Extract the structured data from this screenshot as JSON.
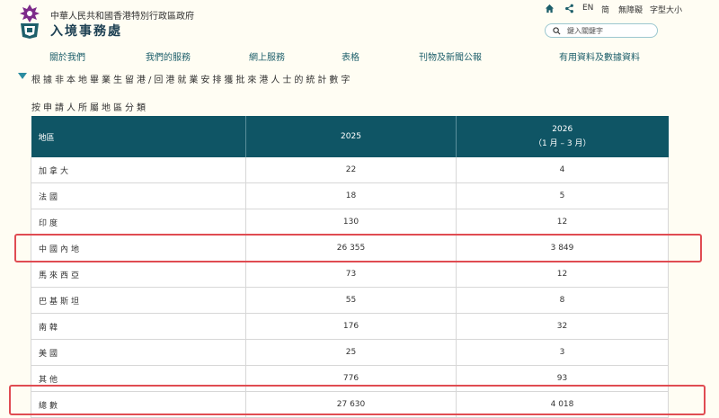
{
  "header": {
    "gov_name": "中華人民共和國香港特別行政區政府",
    "dept_name": "入境事務處",
    "lang_en": "EN",
    "lang_sc": "简",
    "accessibility": "無障礙",
    "font_size": "字型大小",
    "search_placeholder": "鍵入關鍵字"
  },
  "nav": {
    "items": [
      "關於我們",
      "我們的服務",
      "網上服務",
      "表格",
      "刊物及新聞公報",
      "有用資料及數據資料"
    ]
  },
  "section": {
    "title": "根據非本地畢業生留港/回港就業安排獲批來港人士的統計數字",
    "subtitle": "按申請人所屬地區分類"
  },
  "table": {
    "headers": {
      "region": "地區",
      "col1": "2025",
      "col2_year": "2026",
      "col2_period": "（1 月 – 3 月）"
    },
    "rows": [
      {
        "region": "加拿大",
        "v2025": "22",
        "v2026": "4"
      },
      {
        "region": "法國",
        "v2025": "18",
        "v2026": "5"
      },
      {
        "region": "印度",
        "v2025": "130",
        "v2026": "12"
      },
      {
        "region": "中國內地",
        "v2025": "26 355",
        "v2026": "3 849"
      },
      {
        "region": "馬來西亞",
        "v2025": "73",
        "v2026": "12"
      },
      {
        "region": "巴基斯坦",
        "v2025": "55",
        "v2026": "8"
      },
      {
        "region": "南韓",
        "v2025": "176",
        "v2026": "32"
      },
      {
        "region": "美國",
        "v2025": "25",
        "v2026": "3"
      },
      {
        "region": "其他",
        "v2025": "776",
        "v2026": "93"
      },
      {
        "region": "總數",
        "v2025": "27 630",
        "v2026": "4 018"
      }
    ]
  },
  "colors": {
    "header_bg": "#0f5565",
    "highlight": "#e04c52",
    "page_bg": "#fffdf3",
    "accent": "#2a8ca0"
  },
  "icons": [
    "logo-emblem",
    "home-icon",
    "share-icon",
    "search-icon",
    "triangle-down-icon"
  ]
}
